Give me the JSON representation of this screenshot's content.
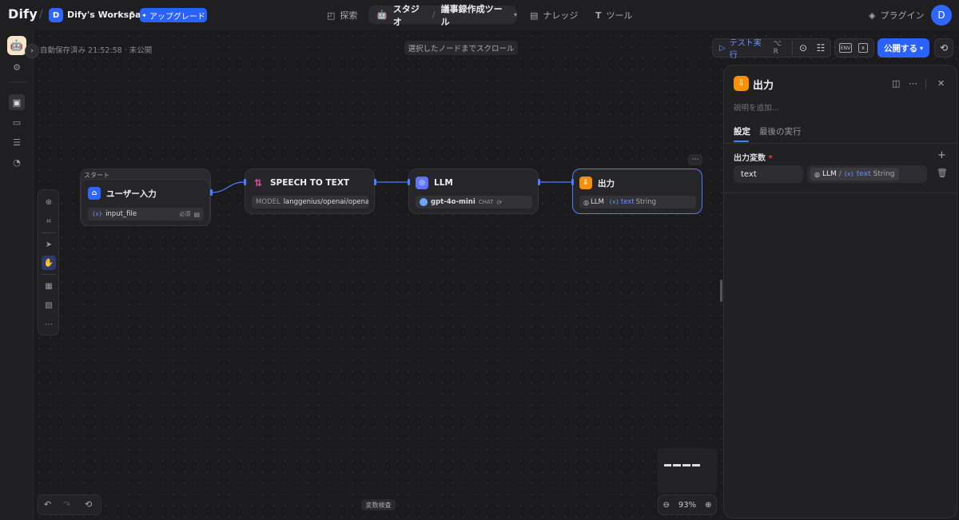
{
  "header": {
    "logo": "Dify",
    "workspace_initial": "D",
    "workspace_name": "Dify's Workspace",
    "upgrade_label": "アップグレード",
    "nav": {
      "explore": "探索",
      "studio": "スタジオ",
      "app_name": "議事録作成ツール",
      "knowledge": "ナレッジ",
      "tools": "ツール",
      "plugins": "プラグイン"
    },
    "user_initial": "D"
  },
  "toolbar": {
    "autosave": "自動保存済み 21:52:58 · 未公開",
    "scroll_to_node": "選択したノードまでスクロール",
    "test_run": "テスト実行",
    "test_run_shortcut": "⌥ R",
    "env_label": "ENV",
    "publish": "公開する"
  },
  "nodes": {
    "start": {
      "tag": "スタート",
      "title": "ユーザー入力",
      "var_symbol": "{x}",
      "var_name": "input_file",
      "required": "必須"
    },
    "stt": {
      "title": "SPEECH TO TEXT",
      "model_label": "MODEL",
      "model_value": "langgenius/openai/openai..."
    },
    "llm": {
      "title": "LLM",
      "model": "gpt-4o-mini",
      "mode": "CHAT"
    },
    "output": {
      "title": "出力",
      "src": "LLM",
      "var_symbol": "{x}",
      "var": "text",
      "type": "String"
    }
  },
  "panel": {
    "title": "出力",
    "description_placeholder": "説明を追加...",
    "tabs": [
      "設定",
      "最後の実行"
    ],
    "section_label": "出力変数",
    "required_mark": "*",
    "variable": {
      "name": "text",
      "src": "LLM",
      "sep": "/",
      "symbol": "{x}",
      "var": "text",
      "type": "String"
    }
  },
  "footer": {
    "variable_inspect": "変数検査",
    "zoom": "93%"
  },
  "colors": {
    "accent": "#2962ff",
    "output_icon": "#f79009",
    "start_icon": "#2f66ff",
    "llm_icon": "#6172f3",
    "stt_icon": "#dd2590"
  }
}
